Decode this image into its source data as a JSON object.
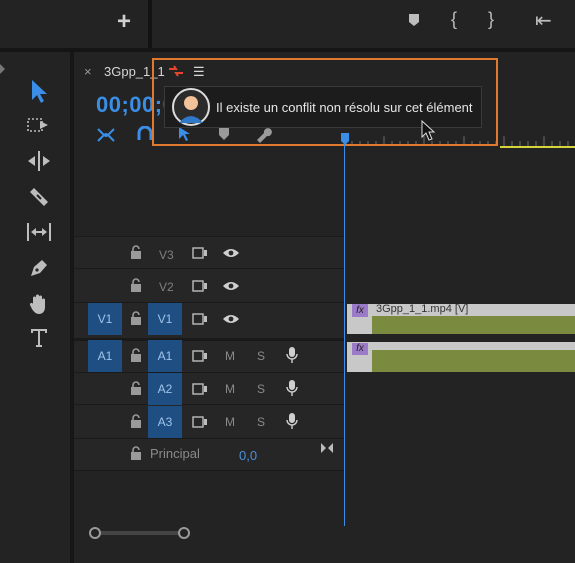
{
  "topbar": {
    "icons": [
      "plus-icon",
      "marker-icon",
      "in-bracket-icon",
      "out-bracket-icon",
      "go-to-in-icon"
    ],
    "glyphs": {
      "plus": "+",
      "in": "{",
      "out": "}",
      "goin": "⇤"
    }
  },
  "tools": [
    "selection-tool",
    "track-select-tool",
    "ripple-edit-tool",
    "razor-tool",
    "slip-tool",
    "pen-tool",
    "hand-tool",
    "type-tool"
  ],
  "tab": {
    "close": "×",
    "title": "3Gpp_1_1",
    "menu": "☰"
  },
  "timecode": "00;00;0",
  "tooltip": {
    "text": "Il existe un conflit non résolu sur cet élément"
  },
  "tracks": {
    "video": [
      {
        "target": "",
        "name": "V3"
      },
      {
        "target": "",
        "name": "V2"
      },
      {
        "target": "V1",
        "name": "V1"
      }
    ],
    "audio": [
      {
        "target": "A1",
        "name": "A1",
        "mute": "M",
        "solo": "S"
      },
      {
        "target": "",
        "name": "A2",
        "mute": "M",
        "solo": "S"
      },
      {
        "target": "",
        "name": "A3",
        "mute": "M",
        "solo": "S"
      }
    ],
    "main_label": "Principal",
    "main_value": "0,0"
  },
  "clip": {
    "video_label": "3Gpp_1_1.mp4 [V]",
    "fx": "fx"
  },
  "colors": {
    "accent": "#3a8ee6",
    "highlight_box": "#e07a2e",
    "clip": "#7a8a3e",
    "target": "#1f4f82"
  }
}
